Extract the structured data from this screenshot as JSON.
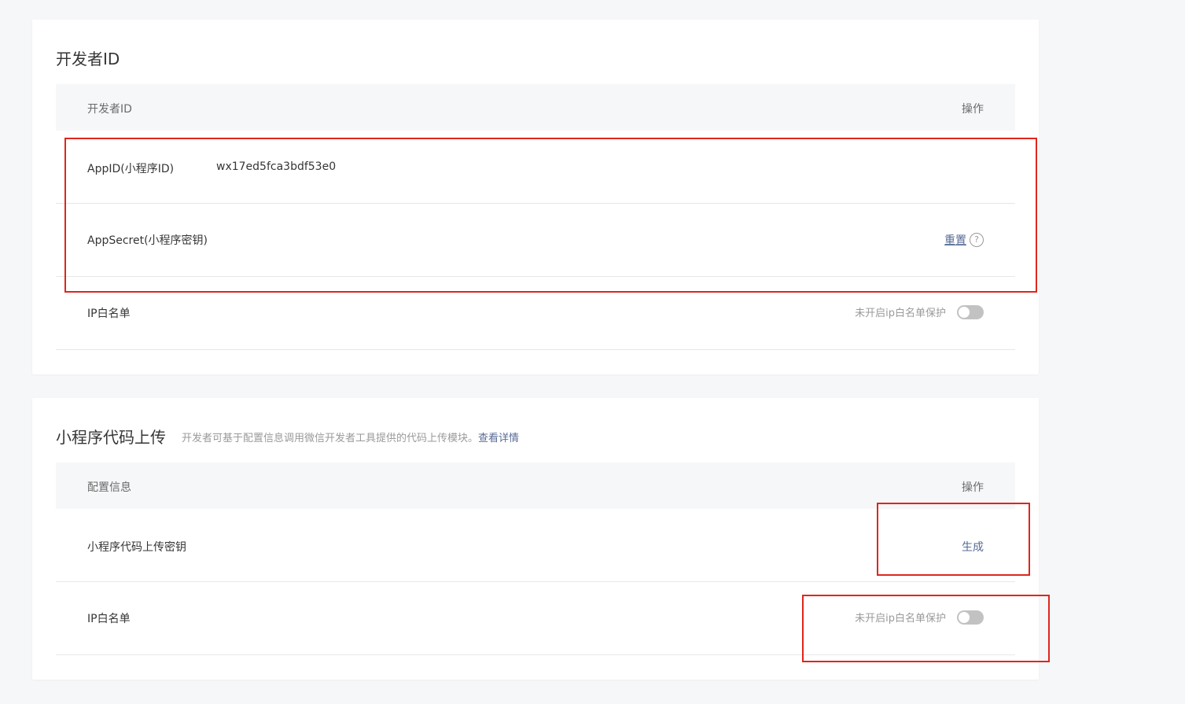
{
  "developer_id": {
    "title": "开发者ID",
    "table_header": {
      "left": "开发者ID",
      "right": "操作"
    },
    "rows": [
      {
        "label": "AppID(小程序ID)",
        "value": "wx17ed5fca3bdf53e0"
      },
      {
        "label": "AppSecret(小程序密钥)",
        "action": "重置",
        "help_icon": "?"
      },
      {
        "label": "IP白名单",
        "status": "未开启ip白名单保护",
        "toggle_on": false
      }
    ]
  },
  "code_upload": {
    "title": "小程序代码上传",
    "description": "开发者可基于配置信息调用微信开发者工具提供的代码上传模块。",
    "description_link": "查看详情",
    "table_header": {
      "left": "配置信息",
      "right": "操作"
    },
    "rows": [
      {
        "label": "小程序代码上传密钥",
        "action": "生成"
      },
      {
        "label": "IP白名单",
        "status": "未开启ip白名单保护",
        "toggle_on": false
      }
    ]
  },
  "colors": {
    "link": "#576b95",
    "highlight_box": "#e0251d",
    "toggle_off": "#c2c2c2"
  }
}
